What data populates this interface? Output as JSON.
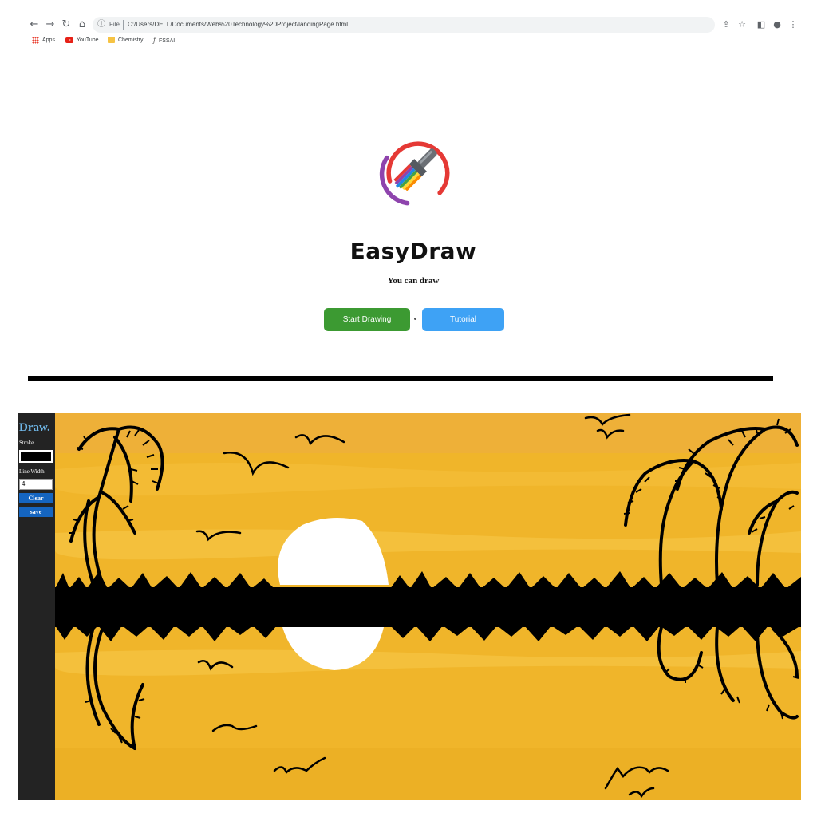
{
  "browser": {
    "nav_icons": [
      "back-icon",
      "forward-icon",
      "reload-icon",
      "home-icon"
    ],
    "info_icon": "info-icon",
    "scheme": "File",
    "url": "C:/Users/DELL/Documents/Web%20Technology%20Project/landingPage.html",
    "right_icons": [
      "share-icon",
      "star-icon",
      "side-panel-icon",
      "profile-icon",
      "menu-icon"
    ],
    "bookmarks": [
      {
        "label": "Apps",
        "icon": "apps-icon"
      },
      {
        "label": "YouTube",
        "icon": "youtube-icon"
      },
      {
        "label": "Chemistry",
        "icon": "folder-icon"
      },
      {
        "label": "FSSAI",
        "icon": "function-icon"
      }
    ]
  },
  "landing": {
    "logo_icon": "paintbrush-logo-icon",
    "title": "EasyDraw",
    "subtitle": "You can draw",
    "start_button": "Start Drawing",
    "tutorial_button": "Tutorial",
    "colors": {
      "start": "#3c9a32",
      "tutorial": "#3ea2f5"
    }
  },
  "app": {
    "brand": "Draw.",
    "stroke_label": "Stroke",
    "stroke_color": "#000000",
    "line_width_label": "Line Width",
    "line_width_value": "4",
    "clear_button": "Clear",
    "save_button": "save",
    "canvas_scene": "sunset-over-lake-drawing",
    "canvas_colors": {
      "sky": "#f0b52a",
      "sun": "#ffffff",
      "ink": "#000000"
    }
  }
}
